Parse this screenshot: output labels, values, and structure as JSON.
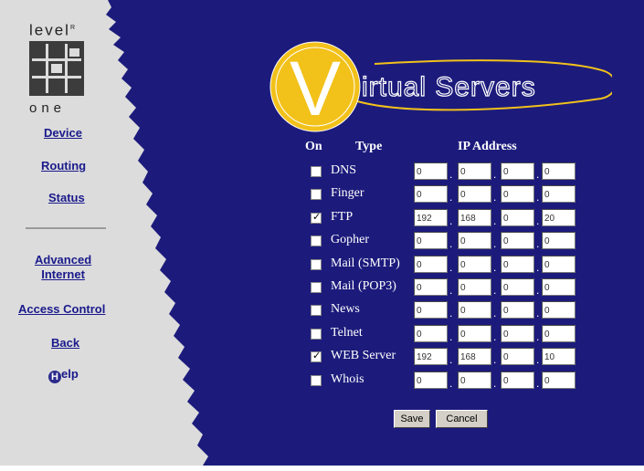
{
  "logo": {
    "top_text": "level",
    "mark": "R",
    "bottom_text": "one"
  },
  "nav": {
    "device": "Device",
    "routing": "Routing",
    "status": "Status",
    "advanced_line1": "Advanced",
    "advanced_line2": "Internet",
    "access_control": "Access Control",
    "back": "Back",
    "help_letter": "H",
    "help_rest": "elp"
  },
  "title": {
    "letter": "V",
    "rest": "irtual Servers"
  },
  "table": {
    "headers": {
      "on": "On",
      "type": "Type",
      "ip": "IP Address"
    },
    "rows": [
      {
        "type": "DNS",
        "checked": false,
        "ip": [
          "0",
          "0",
          "0",
          "0"
        ]
      },
      {
        "type": "Finger",
        "checked": false,
        "ip": [
          "0",
          "0",
          "0",
          "0"
        ]
      },
      {
        "type": "FTP",
        "checked": true,
        "ip": [
          "192",
          "168",
          "0",
          "20"
        ]
      },
      {
        "type": "Gopher",
        "checked": false,
        "ip": [
          "0",
          "0",
          "0",
          "0"
        ]
      },
      {
        "type": "Mail (SMTP)",
        "checked": false,
        "ip": [
          "0",
          "0",
          "0",
          "0"
        ]
      },
      {
        "type": "Mail (POP3)",
        "checked": false,
        "ip": [
          "0",
          "0",
          "0",
          "0"
        ]
      },
      {
        "type": "News",
        "checked": false,
        "ip": [
          "0",
          "0",
          "0",
          "0"
        ]
      },
      {
        "type": "Telnet",
        "checked": false,
        "ip": [
          "0",
          "0",
          "0",
          "0"
        ]
      },
      {
        "type": "WEB Server",
        "checked": true,
        "ip": [
          "192",
          "168",
          "0",
          "10"
        ]
      },
      {
        "type": "Whois",
        "checked": false,
        "ip": [
          "0",
          "0",
          "0",
          "0"
        ]
      }
    ]
  },
  "buttons": {
    "save": "Save",
    "cancel": "Cancel"
  },
  "colors": {
    "background": "#1c1b7c",
    "sidebar": "#dcdcdc",
    "accent": "#f2c11a",
    "nav_link": "#1a1a8c"
  }
}
